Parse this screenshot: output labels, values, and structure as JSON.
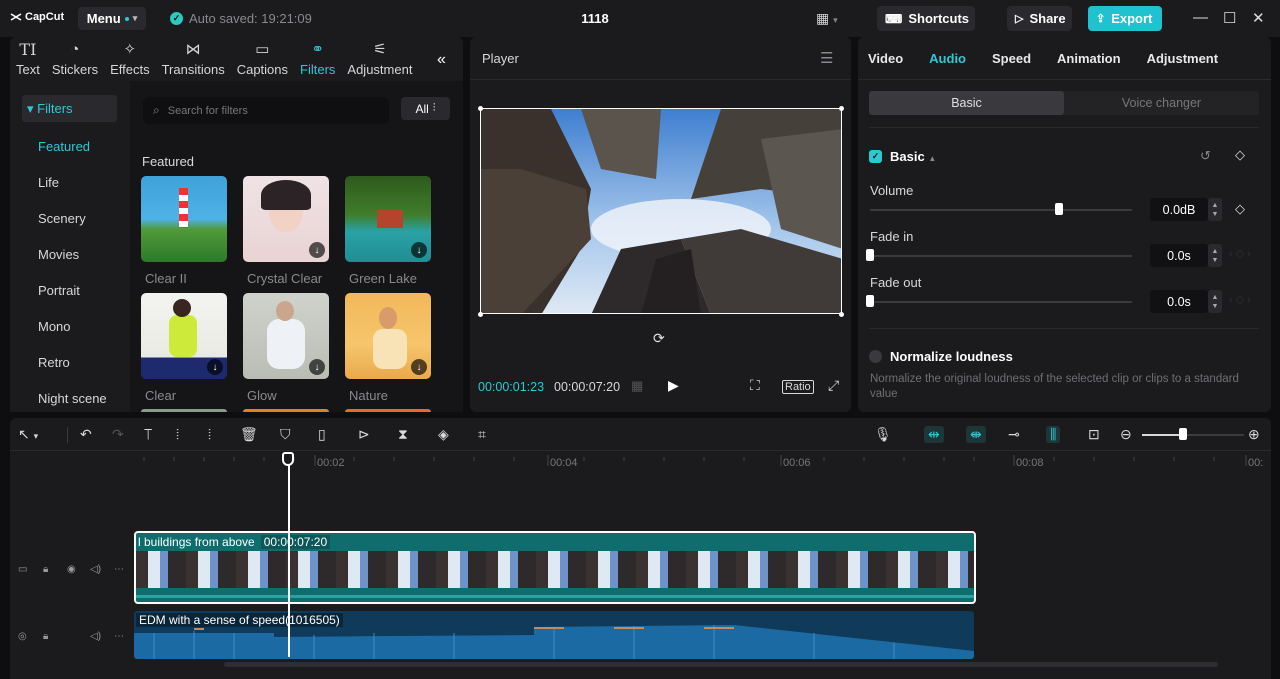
{
  "app": {
    "logo": "CapCut",
    "menu_label": "Menu",
    "autosave": "Auto saved: 19:21:09",
    "project_title": "1118",
    "shortcuts": "Shortcuts",
    "share": "Share",
    "export": "Export",
    "accent": "#2cc9d3"
  },
  "media_tabs": [
    {
      "label": "Text",
      "icon": "text-icon"
    },
    {
      "label": "Stickers",
      "icon": "sticker-icon"
    },
    {
      "label": "Effects",
      "icon": "effects-icon"
    },
    {
      "label": "Transitions",
      "icon": "transitions-icon"
    },
    {
      "label": "Captions",
      "icon": "captions-icon"
    },
    {
      "label": "Filters",
      "icon": "filters-icon",
      "active": true
    },
    {
      "label": "Adjustment",
      "icon": "adjustment-icon"
    }
  ],
  "filters": {
    "section_head": "Filters",
    "categories": [
      "Featured",
      "Life",
      "Scenery",
      "Movies",
      "Portrait",
      "Mono",
      "Retro",
      "Night scene"
    ],
    "active_category": "Featured",
    "search_placeholder": "Search for filters",
    "all_label": "All",
    "featured_heading": "Featured",
    "items": [
      {
        "label": "Clear II"
      },
      {
        "label": "Crystal Clear"
      },
      {
        "label": "Green Lake"
      },
      {
        "label": "Clear"
      },
      {
        "label": "Glow"
      },
      {
        "label": "Nature"
      }
    ]
  },
  "player": {
    "title": "Player",
    "current_time": "00:00:01:23",
    "total_time": "00:00:07:20",
    "ratio_label": "Ratio"
  },
  "inspector": {
    "tabs": [
      "Video",
      "Audio",
      "Speed",
      "Animation",
      "Adjustment"
    ],
    "active_tab": "Audio",
    "segments": [
      "Basic",
      "Voice changer"
    ],
    "basic_label": "Basic",
    "volume": {
      "label": "Volume",
      "value": "0.0dB",
      "level": 0.72
    },
    "fade_in": {
      "label": "Fade in",
      "value": "0.0s",
      "level": 0
    },
    "fade_out": {
      "label": "Fade out",
      "value": "0.0s",
      "level": 0
    },
    "normalize": {
      "label": "Normalize loudness",
      "description": "Normalize the original loudness of the selected clip or clips to a standard value"
    }
  },
  "timeline": {
    "ruler": [
      "00:02",
      "00:04",
      "00:06",
      "00:08",
      "00:"
    ],
    "video_clip": {
      "name": "l buildings from above",
      "duration": "00:00:07:20"
    },
    "audio_clip": {
      "name": "EDM with a sense of speed(1016505)"
    },
    "zoom_level": 0.4
  }
}
